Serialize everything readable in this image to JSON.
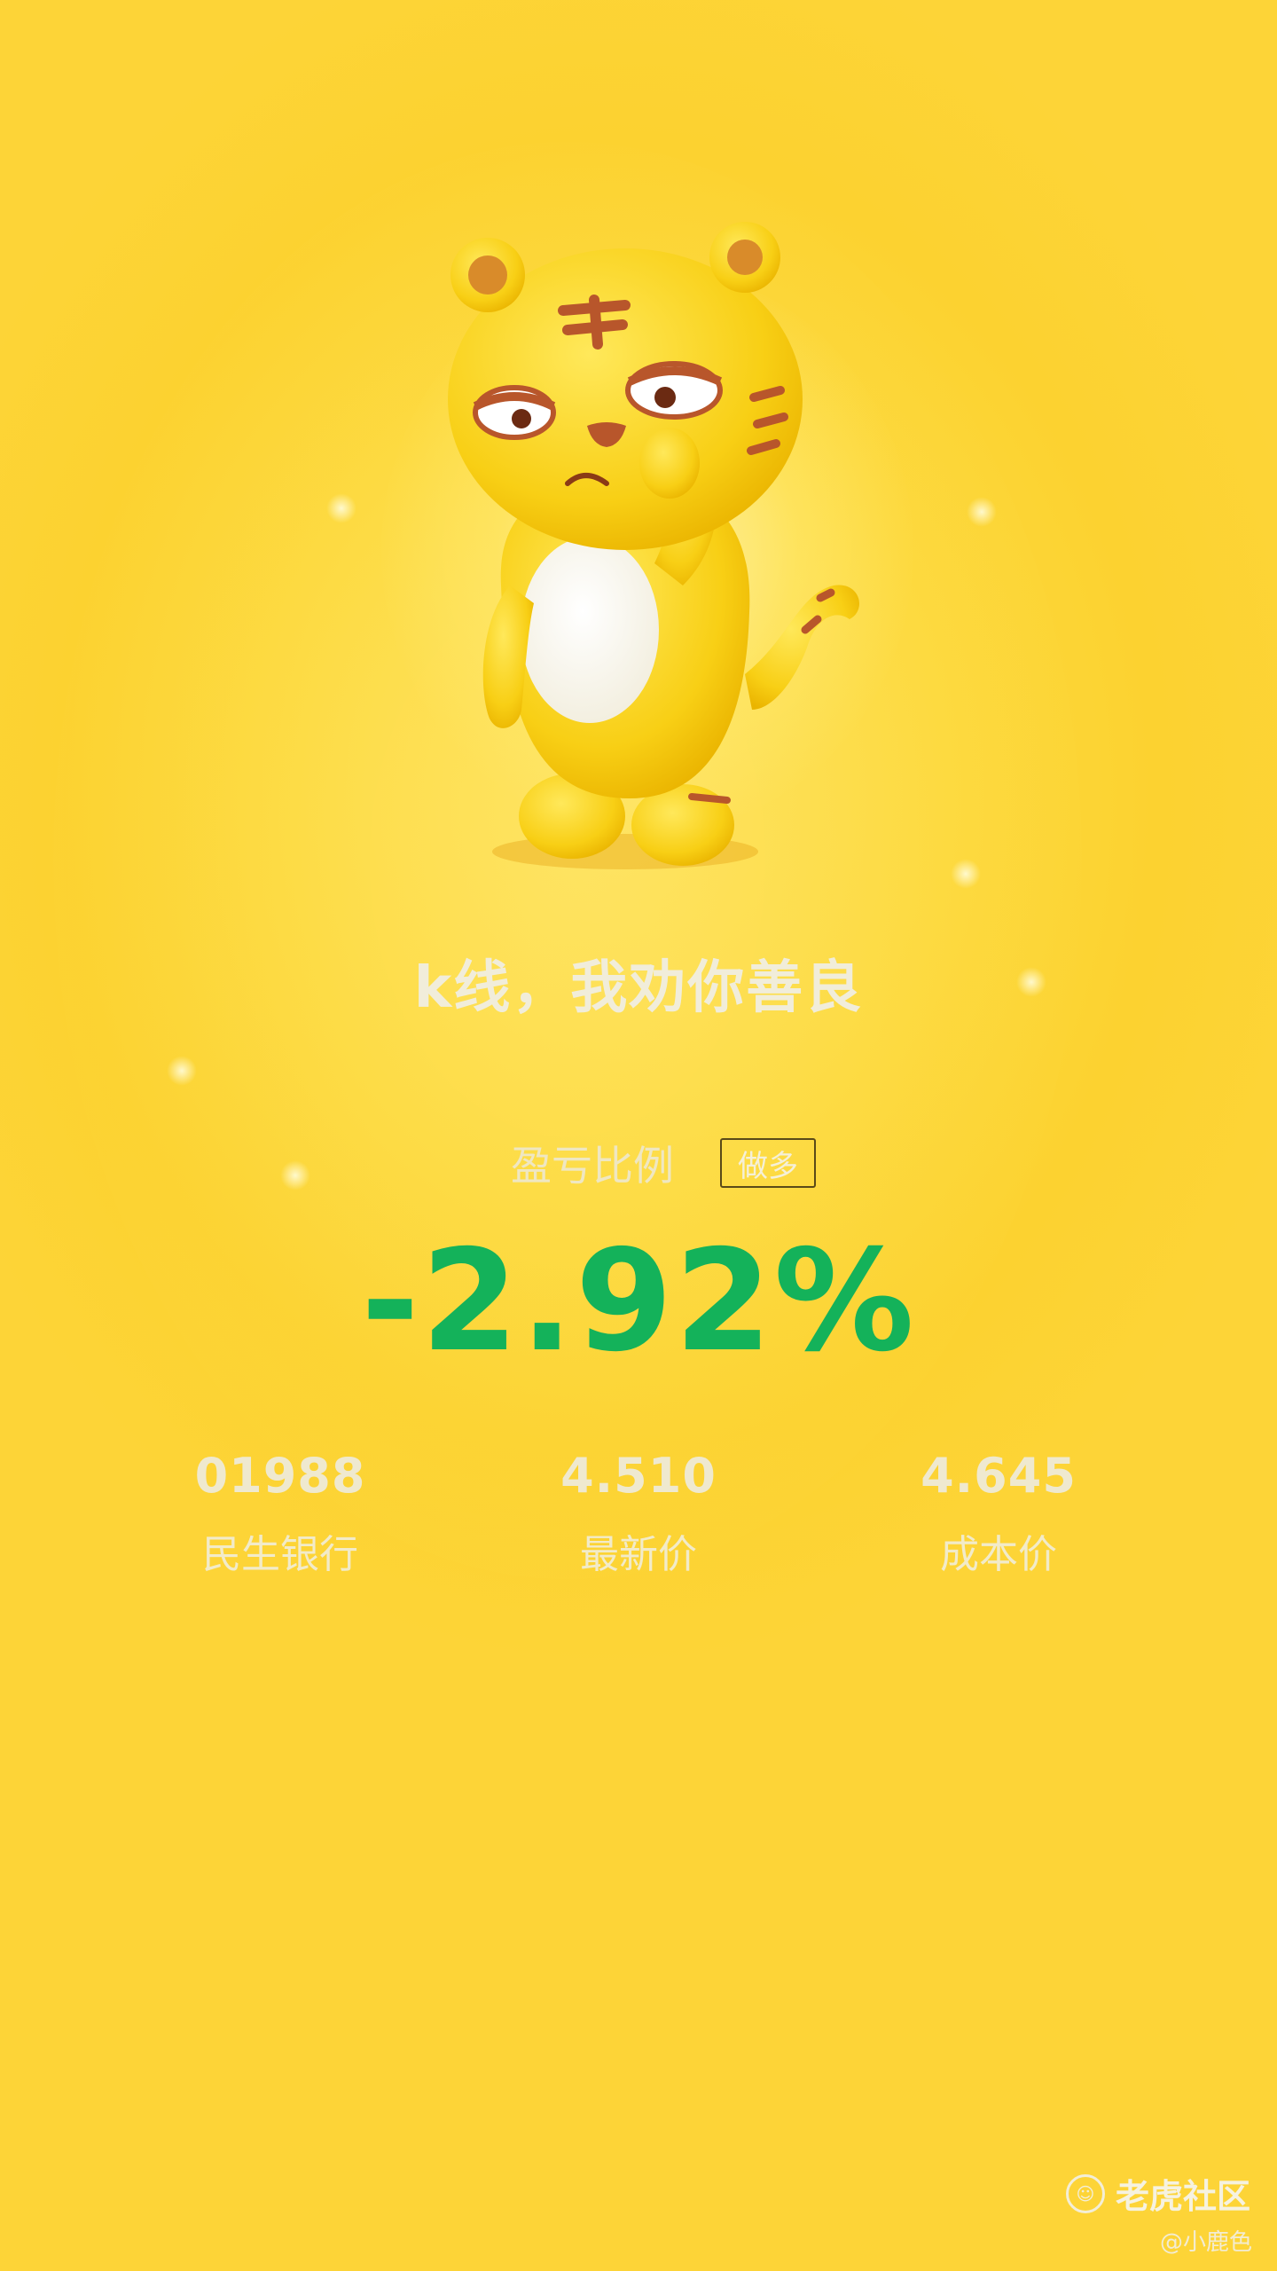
{
  "slogan": "k线，我劝你善良",
  "ratio": {
    "label": "盈亏比例",
    "tag": "做多",
    "value": "-2.92%"
  },
  "stats": [
    {
      "value": "01988",
      "label": "民生银行"
    },
    {
      "value": "4.510",
      "label": "最新价"
    },
    {
      "value": "4.645",
      "label": "成本价"
    }
  ],
  "watermark": {
    "brand": "老虎社区",
    "credit": "@小鹿色"
  },
  "colors": {
    "background": "#fdd83b",
    "loss_green": "#14b25a",
    "text_light": "#f1edda"
  },
  "mascot": "tiger-mascot-icon"
}
